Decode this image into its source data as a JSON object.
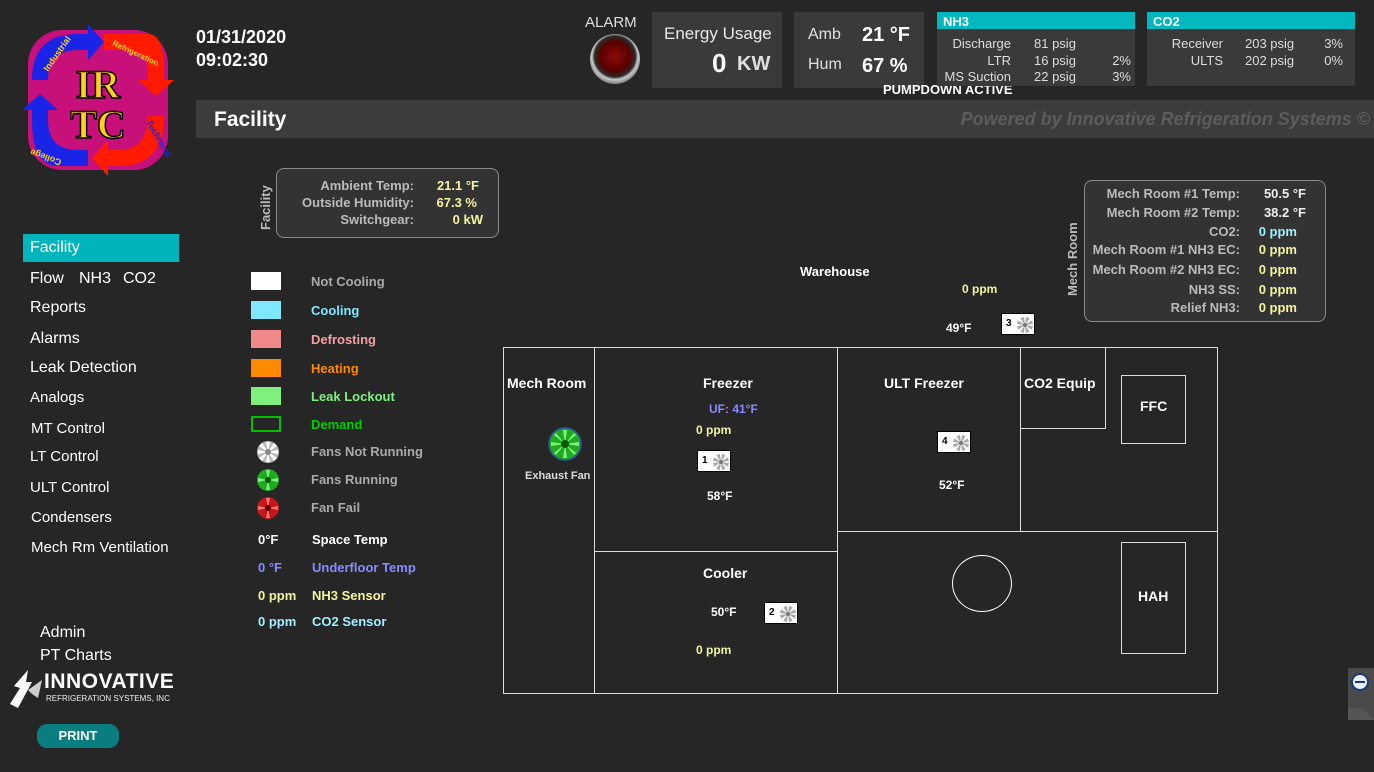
{
  "header": {
    "date": "01/31/2020",
    "time": "09:02:30",
    "alarm_label": "ALARM",
    "energy_label": "Energy Usage",
    "energy_value": "0",
    "energy_unit": "KW",
    "amb_label": "Amb",
    "amb_value": "21 °F",
    "hum_label": "Hum",
    "hum_value": "67 %",
    "status": "PUMPDOWN ACTIVE"
  },
  "nh3": {
    "title": "NH3",
    "rows": [
      {
        "label": "Discharge",
        "value": "81 psig",
        "pct": ""
      },
      {
        "label": "LTR",
        "value": "16 psig",
        "pct": "2%"
      },
      {
        "label": "MS Suction",
        "value": "22 psig",
        "pct": "3%"
      }
    ]
  },
  "co2": {
    "title": "CO2",
    "rows": [
      {
        "label": "Receiver",
        "value": "203 psig",
        "pct": "3%"
      },
      {
        "label": "ULTS",
        "value": "202 psig",
        "pct": "0%"
      }
    ]
  },
  "logo": {
    "line1": "IR",
    "line2": "TC",
    "ring_top": "Industrial",
    "ring_right_top": "Refrigeration",
    "ring_right": "Technical",
    "ring_bottom": "College"
  },
  "titlebar": {
    "title": "Facility",
    "powered": "Powered by Innovative Refrigeration Systems ©"
  },
  "nav": {
    "items": [
      "Facility",
      "Flow",
      "NH3",
      "CO2",
      "Reports",
      "Alarms",
      "Leak Detection",
      "Analogs",
      "MT Control",
      "LT Control",
      "ULT Control",
      "Condensers",
      "Mech Rm Ventilation"
    ],
    "admin": "Admin",
    "pt_charts": "PT Charts"
  },
  "brand": {
    "name": "INNOVATIVE",
    "sub": "REFRIGERATION SYSTEMS, INC"
  },
  "print_label": "PRINT",
  "facility_box": {
    "vertical_label": "Facility",
    "rows": [
      {
        "label": "Ambient Temp:",
        "value": "21.1 °F"
      },
      {
        "label": "Outside Humidity:",
        "value": "67.3 %"
      },
      {
        "label": "Switchgear:",
        "value": "0 kW"
      }
    ]
  },
  "mech_box": {
    "vertical_label": "Mech Room",
    "rows": [
      {
        "label": "Mech Room #1 Temp:",
        "value": "50.5 °F"
      },
      {
        "label": "Mech Room #2 Temp:",
        "value": "38.2 °F"
      },
      {
        "label": "CO2:",
        "value": "0 ppm"
      },
      {
        "label": "Mech Room #1 NH3 EC:",
        "value": "0 ppm"
      },
      {
        "label": "Mech Room #2 NH3 EC:",
        "value": "0 ppm"
      },
      {
        "label": "NH3 SS:",
        "value": "0 ppm"
      },
      {
        "label": "Relief NH3:",
        "value": "0 ppm"
      }
    ]
  },
  "legend": {
    "not_cooling": "Not Cooling",
    "cooling": "Cooling",
    "defrosting": "Defrosting",
    "heating": "Heating",
    "leak_lockout": "Leak Lockout",
    "demand": "Demand",
    "fans_not_running": "Fans Not Running",
    "fans_running": "Fans Running",
    "fan_fail": "Fan Fail",
    "space_temp_sample": "0°F",
    "space_temp": "Space Temp",
    "underfloor_sample": "0 °F",
    "underfloor_temp": "Underfloor Temp",
    "nh3_sample": "0 ppm",
    "nh3_sensor": "NH3 Sensor",
    "co2_sample": "0 ppm",
    "co2_sensor": "CO2 Sensor"
  },
  "plan": {
    "warehouse": "Warehouse",
    "warehouse_ppm": "0 ppm",
    "warehouse_temp": "49°F",
    "mech_room": "Mech Room",
    "exhaust_fan": "Exhaust Fan",
    "freezer": "Freezer",
    "freezer_uf": "UF: 41°F",
    "freezer_ppm": "0 ppm",
    "freezer_temp": "58°F",
    "ult_freezer": "ULT Freezer",
    "ult_temp": "52°F",
    "co2_equip": "CO2 Equip",
    "ffc": "FFC",
    "hah": "HAH",
    "cooler": "Cooler",
    "cooler_temp": "50°F",
    "cooler_ppm": "0 ppm",
    "fan1": "1",
    "fan2": "2",
    "fan3": "3",
    "fan4": "4"
  },
  "colors": {
    "accent": "#00b4bb",
    "cooling": "#7fe8ff",
    "defrosting": "#f08a8a",
    "heating": "#ff8a00",
    "leak_lockout": "#7ff07f",
    "demand": "#00c000",
    "ppm": "#f3f3a0",
    "underfloor": "#8a8aff",
    "co2_sensor": "#a0f0ff"
  }
}
